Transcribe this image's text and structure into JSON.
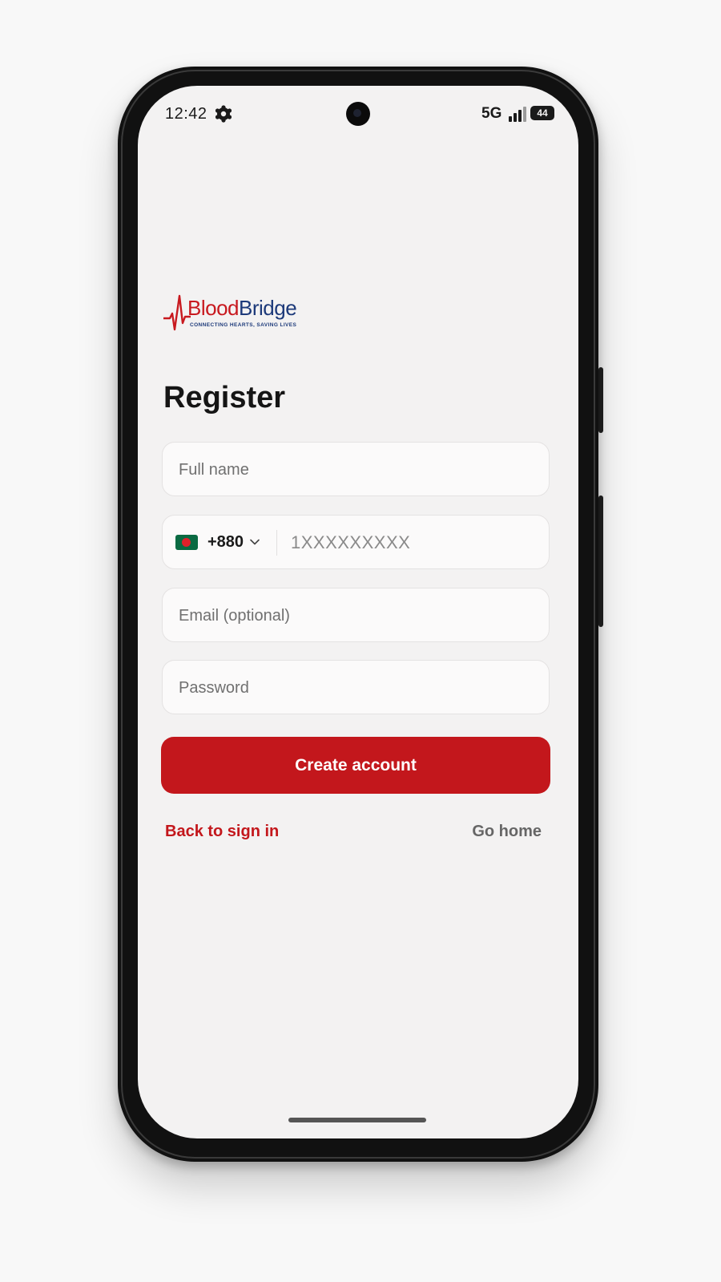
{
  "status_bar": {
    "time": "12:42",
    "network": "5G",
    "battery": "44",
    "icons": [
      "settings-gear-icon",
      "signal-icon",
      "battery-icon"
    ]
  },
  "brand": {
    "name_part1": "Blood",
    "name_part2": "Bridge",
    "tagline": "CONNECTING HEARTS, SAVING LIVES",
    "primary_color": "#c3171c",
    "secondary_color": "#1d3a7a",
    "icon": "heartbeat-pulse-icon"
  },
  "page": {
    "title": "Register"
  },
  "form": {
    "full_name": {
      "placeholder": "Full name",
      "value": ""
    },
    "phone": {
      "country_flag": "bangladesh-flag-icon",
      "dial_code": "+880",
      "placeholder": "1XXXXXXXXX",
      "value": ""
    },
    "email": {
      "placeholder": "Email (optional)",
      "value": ""
    },
    "password": {
      "placeholder": "Password",
      "value": ""
    },
    "submit_label": "Create account"
  },
  "links": {
    "back_to_sign_in": "Back to sign in",
    "go_home": "Go home"
  }
}
